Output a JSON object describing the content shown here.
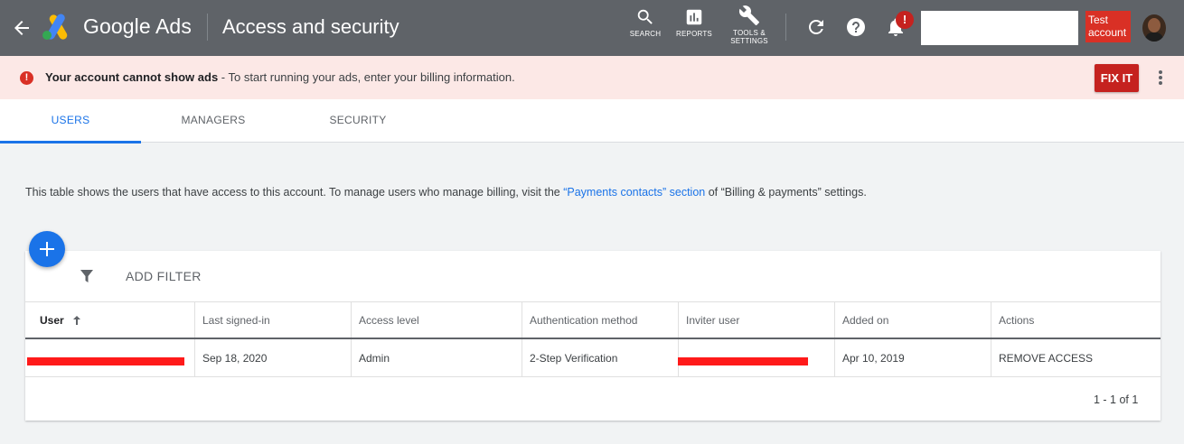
{
  "header": {
    "product_name": "Google Ads",
    "page_title": "Access and security",
    "tools": [
      {
        "label_line1": "SEARCH",
        "label_line2": "",
        "icon": "search-icon"
      },
      {
        "label_line1": "REPORTS",
        "label_line2": "",
        "icon": "reports-icon"
      },
      {
        "label_line1": "TOOLS &",
        "label_line2": "SETTINGS",
        "icon": "wrench-icon"
      }
    ],
    "notification_badge": "!",
    "test_account_line1": "Test",
    "test_account_line2": "account"
  },
  "alert": {
    "icon": "!",
    "bold_text": "Your account cannot show ads",
    "text": " - To start running your ads, enter your billing information.",
    "action_label": "FIX IT"
  },
  "tabs": [
    {
      "label": "USERS",
      "active": true
    },
    {
      "label": "MANAGERS",
      "active": false
    },
    {
      "label": "SECURITY",
      "active": false
    }
  ],
  "description": {
    "before_link": "This table shows the users that have access to this account. To manage users who manage billing, visit the ",
    "link_text": "“Payments contacts” section",
    "after_link": " of “Billing & payments” settings."
  },
  "toolbar": {
    "add_filter_label": "ADD FILTER"
  },
  "table": {
    "columns": [
      "User",
      "Last signed-in",
      "Access level",
      "Authentication method",
      "Inviter user",
      "Added on",
      "Actions"
    ],
    "rows": [
      {
        "user": "",
        "last_signed_in": "Sep 18, 2020",
        "access_level": "Admin",
        "auth_method": "2-Step Verification",
        "inviter_user": "",
        "added_on": "Apr 10, 2019",
        "action": "REMOVE ACCESS"
      }
    ],
    "pagination": "1 - 1 of 1"
  },
  "colors": {
    "topbar": "#5f6368",
    "accent": "#1a73e8",
    "alert_bg": "#fce8e6",
    "alert_red": "#d93025",
    "redaction": "#ff1a1a"
  }
}
